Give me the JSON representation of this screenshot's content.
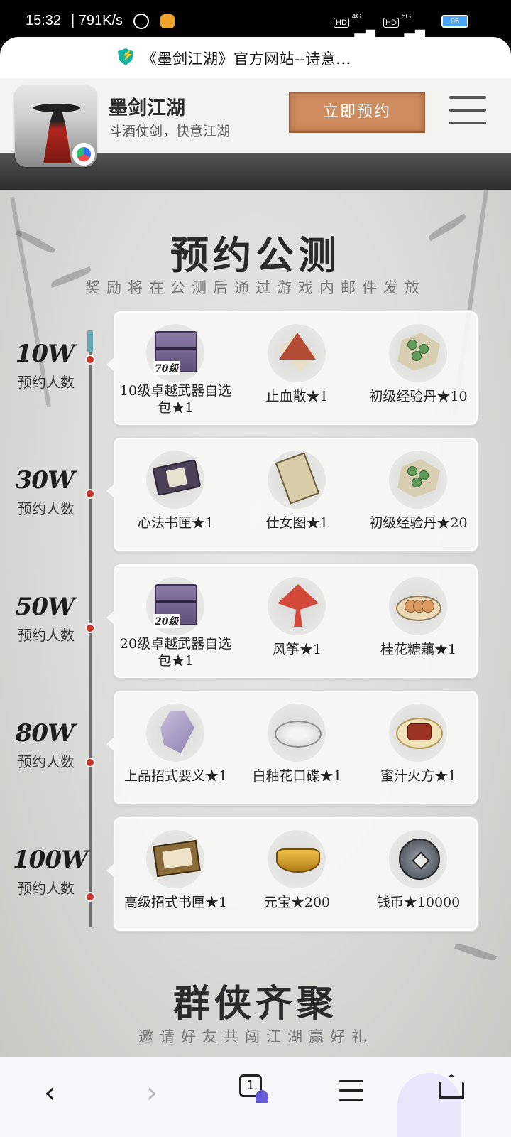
{
  "status_bar": {
    "time": "15:32",
    "speed": "791K/s",
    "net1": "4G",
    "net2": "5G",
    "hd": "HD",
    "battery": "96"
  },
  "url_bar": {
    "title": "《墨剑江湖》官方网站--诗意..."
  },
  "app": {
    "name": "墨剑江湖",
    "slogan": "斗酒仗剑，快意江湖",
    "reserve_button": "立即预约"
  },
  "section_reserve": {
    "title": "预约公测",
    "subtitle": "奖励将在公测后通过游戏内邮件发放"
  },
  "tiers": [
    {
      "level": "10W",
      "label": "预约人数",
      "items": [
        {
          "name": "10级卓越武器自选包★1",
          "icon": "weapon-gift-box-icon",
          "tag": "70级"
        },
        {
          "name": "止血散★1",
          "icon": "hemostatic-powder-icon"
        },
        {
          "name": "初级经验丹★10",
          "icon": "exp-pill-icon"
        }
      ]
    },
    {
      "level": "30W",
      "label": "预约人数",
      "items": [
        {
          "name": "心法书匣★1",
          "icon": "book-case-icon"
        },
        {
          "name": "仕女图★1",
          "icon": "scroll-painting-icon"
        },
        {
          "name": "初级经验丹★20",
          "icon": "exp-pill-icon"
        }
      ]
    },
    {
      "level": "50W",
      "label": "预约人数",
      "items": [
        {
          "name": "20级卓越武器自选包★1",
          "icon": "weapon-gift-box-icon",
          "tag": "20级"
        },
        {
          "name": "风筝★1",
          "icon": "kite-icon"
        },
        {
          "name": "桂花糖藕★1",
          "icon": "lotus-root-dish-icon"
        }
      ]
    },
    {
      "level": "80W",
      "label": "预约人数",
      "items": [
        {
          "name": "上品招式要义★1",
          "icon": "skill-manual-icon"
        },
        {
          "name": "白釉花口碟★1",
          "icon": "porcelain-dish-icon"
        },
        {
          "name": "蜜汁火方★1",
          "icon": "honey-ham-dish-icon"
        }
      ]
    },
    {
      "level": "100W",
      "label": "预约人数",
      "items": [
        {
          "name": "高级招式书匣★1",
          "icon": "skill-book-chest-icon"
        },
        {
          "name": "元宝★200",
          "icon": "gold-ingot-icon"
        },
        {
          "name": "钱币★10000",
          "icon": "coin-icon"
        }
      ]
    }
  ],
  "section_invite": {
    "title": "群侠齐聚",
    "subtitle": "邀请好友共闯江湖赢好礼"
  },
  "bottom_nav": {
    "back": "‹",
    "forward": "›",
    "tab_count": "1"
  },
  "colors": {
    "accent_button": "#cf8d5f",
    "timeline_dot": "#c2342c"
  }
}
